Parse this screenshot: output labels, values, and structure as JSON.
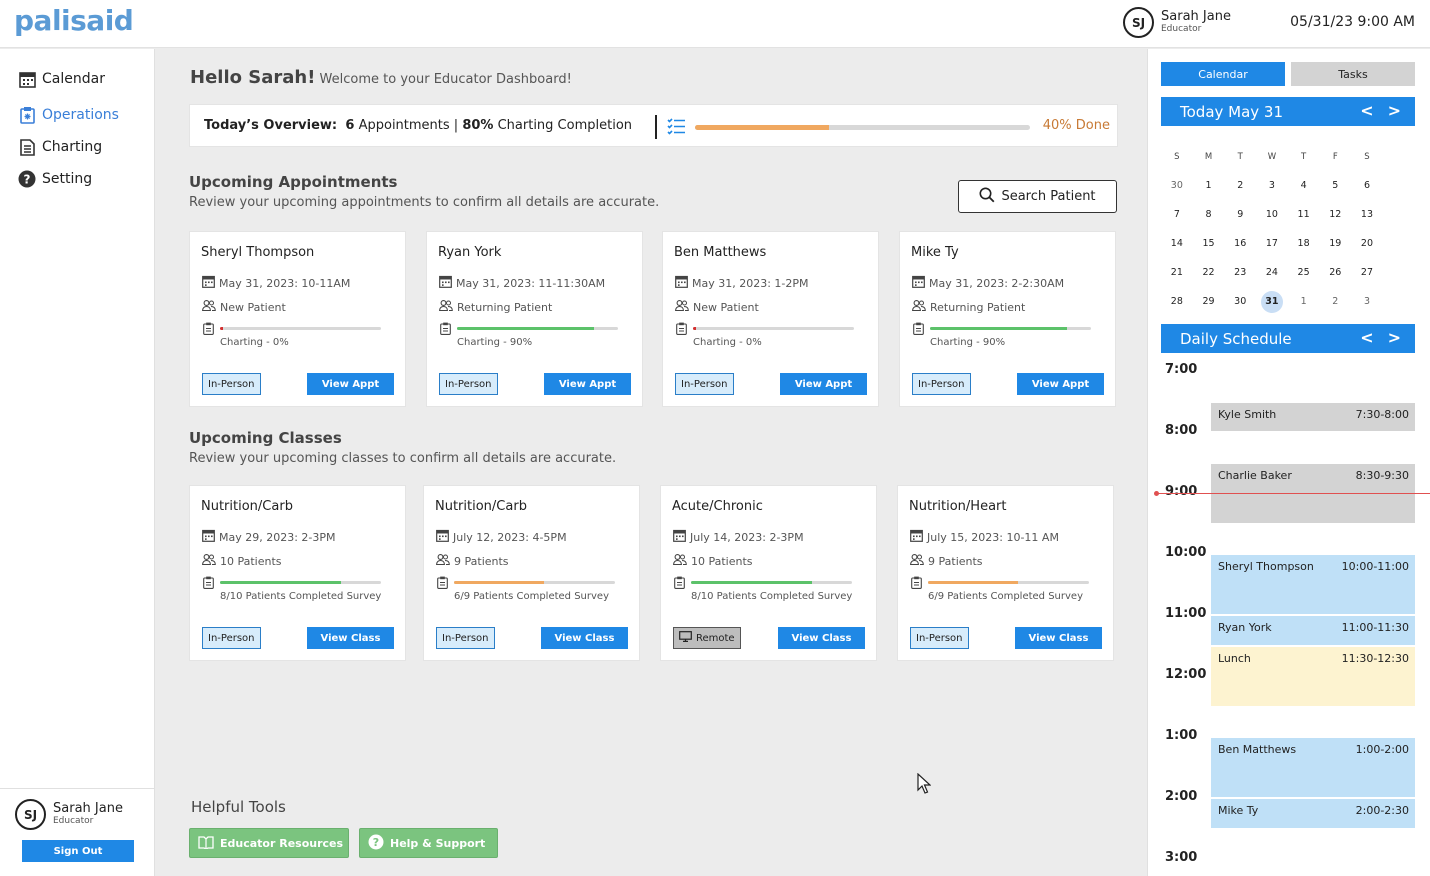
{
  "app": {
    "logo": "palisaid"
  },
  "user": {
    "initials": "SJ",
    "name": "Sarah Jane",
    "role": "Educator"
  },
  "datetime": "05/31/23  9:00 AM",
  "nav": [
    {
      "label": "Calendar",
      "icon": "calendar-icon"
    },
    {
      "label": "Operations",
      "icon": "clipboard-icon",
      "active": true
    },
    {
      "label": "Charting",
      "icon": "document-icon"
    },
    {
      "label": "Setting",
      "icon": "help-circle-icon"
    }
  ],
  "sign_out": "Sign Out",
  "greeting": {
    "hello": "Hello Sarah!",
    "welcome": "Welcome to your Educator Dashboard!"
  },
  "overview": {
    "label": "Today’s Overview:",
    "appointments_count": "6",
    "appointments_label": "Appointments |",
    "charting_pct": "80%",
    "charting_label": "Charting Completion",
    "progress": 0.4,
    "done_text": "40% Done"
  },
  "appointments_section": {
    "title": "Upcoming Appointments",
    "subtitle": "Review your upcoming appointments to confirm all details are accurate.",
    "search_label": "Search Patient"
  },
  "appointments": [
    {
      "name": "Sheryl Thompson",
      "date": "May 31, 2023: 10-11AM",
      "type": "New Patient",
      "charting": "Charting - 0%",
      "progress": 0.02,
      "bar_color": "#d32f2f",
      "mode": "In-Person",
      "button": "View Appt"
    },
    {
      "name": "Ryan York",
      "date": "May 31, 2023: 11-11:30AM",
      "type": "Returning Patient",
      "charting": "Charting - 90%",
      "progress": 0.85,
      "bar_color": "#5cc26a",
      "mode": "In-Person",
      "button": "View Appt"
    },
    {
      "name": "Ben Matthews",
      "date": "May 31, 2023: 1-2PM",
      "type": "New Patient",
      "charting": "Charting - 0%",
      "progress": 0.02,
      "bar_color": "#d32f2f",
      "mode": "In-Person",
      "button": "View Appt"
    },
    {
      "name": "Mike Ty",
      "date": "May 31, 2023: 2-2:30AM",
      "type": "Returning Patient",
      "charting": "Charting - 90%",
      "progress": 0.85,
      "bar_color": "#5cc26a",
      "mode": "In-Person",
      "button": "View Appt"
    }
  ],
  "classes_section": {
    "title": "Upcoming Classes",
    "subtitle": "Review your upcoming classes to confirm all details are accurate."
  },
  "classes": [
    {
      "name": "Nutrition/Carb",
      "date": "May 29, 2023: 2-3PM",
      "patients": "10 Patients",
      "survey": "8/10 Patients Completed Survey",
      "progress": 0.75,
      "bar_color": "#5cc26a",
      "mode": "In-Person",
      "remote": false,
      "button": "View Class"
    },
    {
      "name": "Nutrition/Carb",
      "date": "July 12, 2023: 4-5PM",
      "patients": "9 Patients",
      "survey": "6/9 Patients Completed Survey",
      "progress": 0.56,
      "bar_color": "#f0a860",
      "mode": "In-Person",
      "remote": false,
      "button": "View Class"
    },
    {
      "name": "Acute/Chronic",
      "date": "July 14, 2023: 2-3PM",
      "patients": "10 Patients",
      "survey": "8/10 Patients Completed Survey",
      "progress": 0.75,
      "bar_color": "#5cc26a",
      "mode": "Remote",
      "remote": true,
      "button": "View Class"
    },
    {
      "name": "Nutrition/Heart",
      "date": "July 15, 2023: 10-11 AM",
      "patients": "9 Patients",
      "survey": "6/9 Patients Completed Survey",
      "progress": 0.56,
      "bar_color": "#f0a860",
      "mode": "In-Person",
      "remote": false,
      "button": "View Class"
    }
  ],
  "tools": {
    "title": "Helpful Tools",
    "resources": "Educator Resources",
    "help": "Help & Support"
  },
  "right_panel": {
    "tab_calendar": "Calendar",
    "tab_tasks": "Tasks",
    "calendar_title": "Today May 31",
    "prev": "<",
    "next": ">",
    "weekdays": [
      "S",
      "M",
      "T",
      "W",
      "T",
      "F",
      "S"
    ],
    "weeks": [
      [
        "30",
        "1",
        "2",
        "3",
        "4",
        "5",
        "6"
      ],
      [
        "7",
        "8",
        "9",
        "10",
        "11",
        "12",
        "13"
      ],
      [
        "14",
        "15",
        "16",
        "17",
        "18",
        "19",
        "20"
      ],
      [
        "21",
        "22",
        "23",
        "24",
        "25",
        "26",
        "27"
      ],
      [
        "28",
        "29",
        "30",
        "31",
        "1",
        "2",
        "3"
      ]
    ],
    "today": "31",
    "schedule_title": "Daily Schedule",
    "hours": [
      "7:00",
      "8:00",
      "9:00",
      "10:00",
      "11:00",
      "12:00",
      "1:00",
      "2:00",
      "3:00"
    ],
    "events": [
      {
        "name": "Kyle Smith",
        "time": "7:30-8:00",
        "start": 7.5,
        "end": 8.0,
        "color": "gray"
      },
      {
        "name": "Charlie Baker",
        "time": "8:30-9:30",
        "start": 8.5,
        "end": 9.5,
        "color": "gray"
      },
      {
        "name": "Sheryl Thompson",
        "time": "10:00-11:00",
        "start": 10.0,
        "end": 11.0,
        "color": "blue"
      },
      {
        "name": "Ryan York",
        "time": "11:00-11:30",
        "start": 11.0,
        "end": 11.5,
        "color": "blue"
      },
      {
        "name": "Lunch",
        "time": "11:30-12:30",
        "start": 11.5,
        "end": 12.5,
        "color": "yellow"
      },
      {
        "name": "Ben Matthews",
        "time": "1:00-2:00",
        "start": 13.0,
        "end": 14.0,
        "color": "blue"
      },
      {
        "name": "Mike Ty",
        "time": "2:00-2:30",
        "start": 14.0,
        "end": 14.5,
        "color": "blue"
      }
    ],
    "current_time": 9.0
  }
}
